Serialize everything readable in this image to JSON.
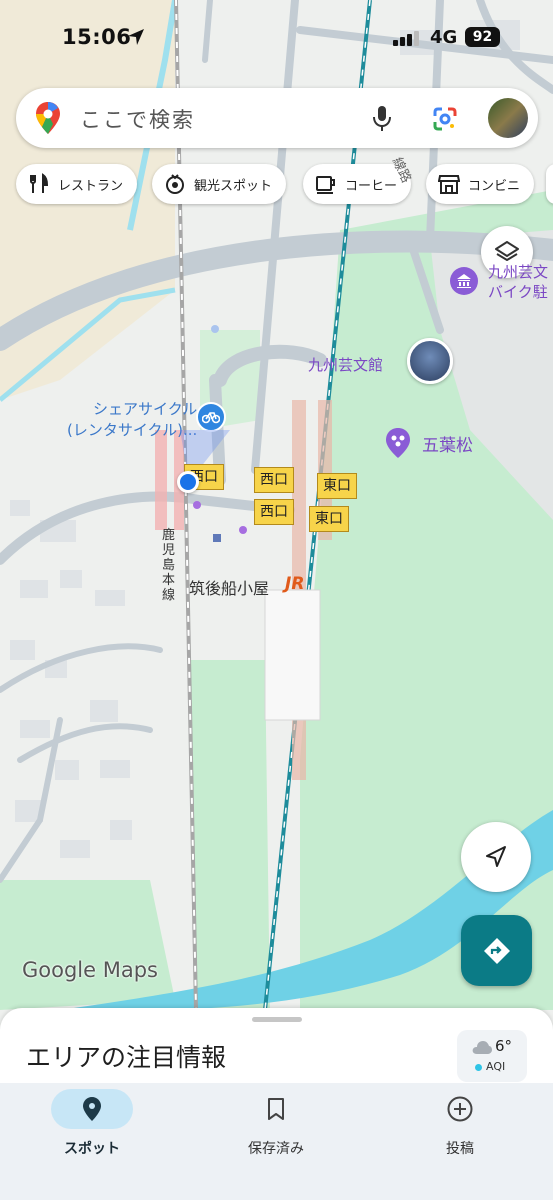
{
  "status_bar": {
    "time": "15:06",
    "network": "4G",
    "battery": "92"
  },
  "search": {
    "placeholder": "ここで検索"
  },
  "chips": [
    {
      "label": "レストラン",
      "icon": "fork-knife-icon"
    },
    {
      "label": "観光スポット",
      "icon": "camera-landmark-icon"
    },
    {
      "label": "コーヒー",
      "icon": "coffee-cup-icon"
    },
    {
      "label": "コンビニ",
      "icon": "store-icon"
    }
  ],
  "map": {
    "places": {
      "share_cycle_line1": "シェアサイクル",
      "share_cycle_line2": "(レンタサイクル)...",
      "kyushu_geibunkan": "九州芸文館",
      "goyomatsu": "五葉松",
      "station": "筑後船小屋",
      "rail_line": "鹿児島本線",
      "top_right_line1": "九州芸文",
      "top_right_line2": "バイク駐",
      "street_right": "線路"
    },
    "exits": {
      "west1": "西口",
      "west2": "西口",
      "west3": "西口",
      "east1": "東口",
      "east2": "東口"
    },
    "watermark": "Google Maps",
    "rail_logo": "JR"
  },
  "sheet": {
    "title": "エリアの注目情報",
    "temperature": "6°",
    "aqi_label": "AQI"
  },
  "nav": [
    {
      "label": "スポット",
      "icon": "location-pin-icon",
      "active": true
    },
    {
      "label": "保存済み",
      "icon": "bookmark-icon",
      "active": false
    },
    {
      "label": "投稿",
      "icon": "plus-circle-icon",
      "active": false
    }
  ],
  "colors": {
    "accent": "#0b7b86",
    "nav_active_pill": "#c7e6f6",
    "park_green": "#c6ecd0",
    "water": "#6fd1e6",
    "exit_yellow": "#f7d44a",
    "location_blue": "#1a73e8"
  }
}
